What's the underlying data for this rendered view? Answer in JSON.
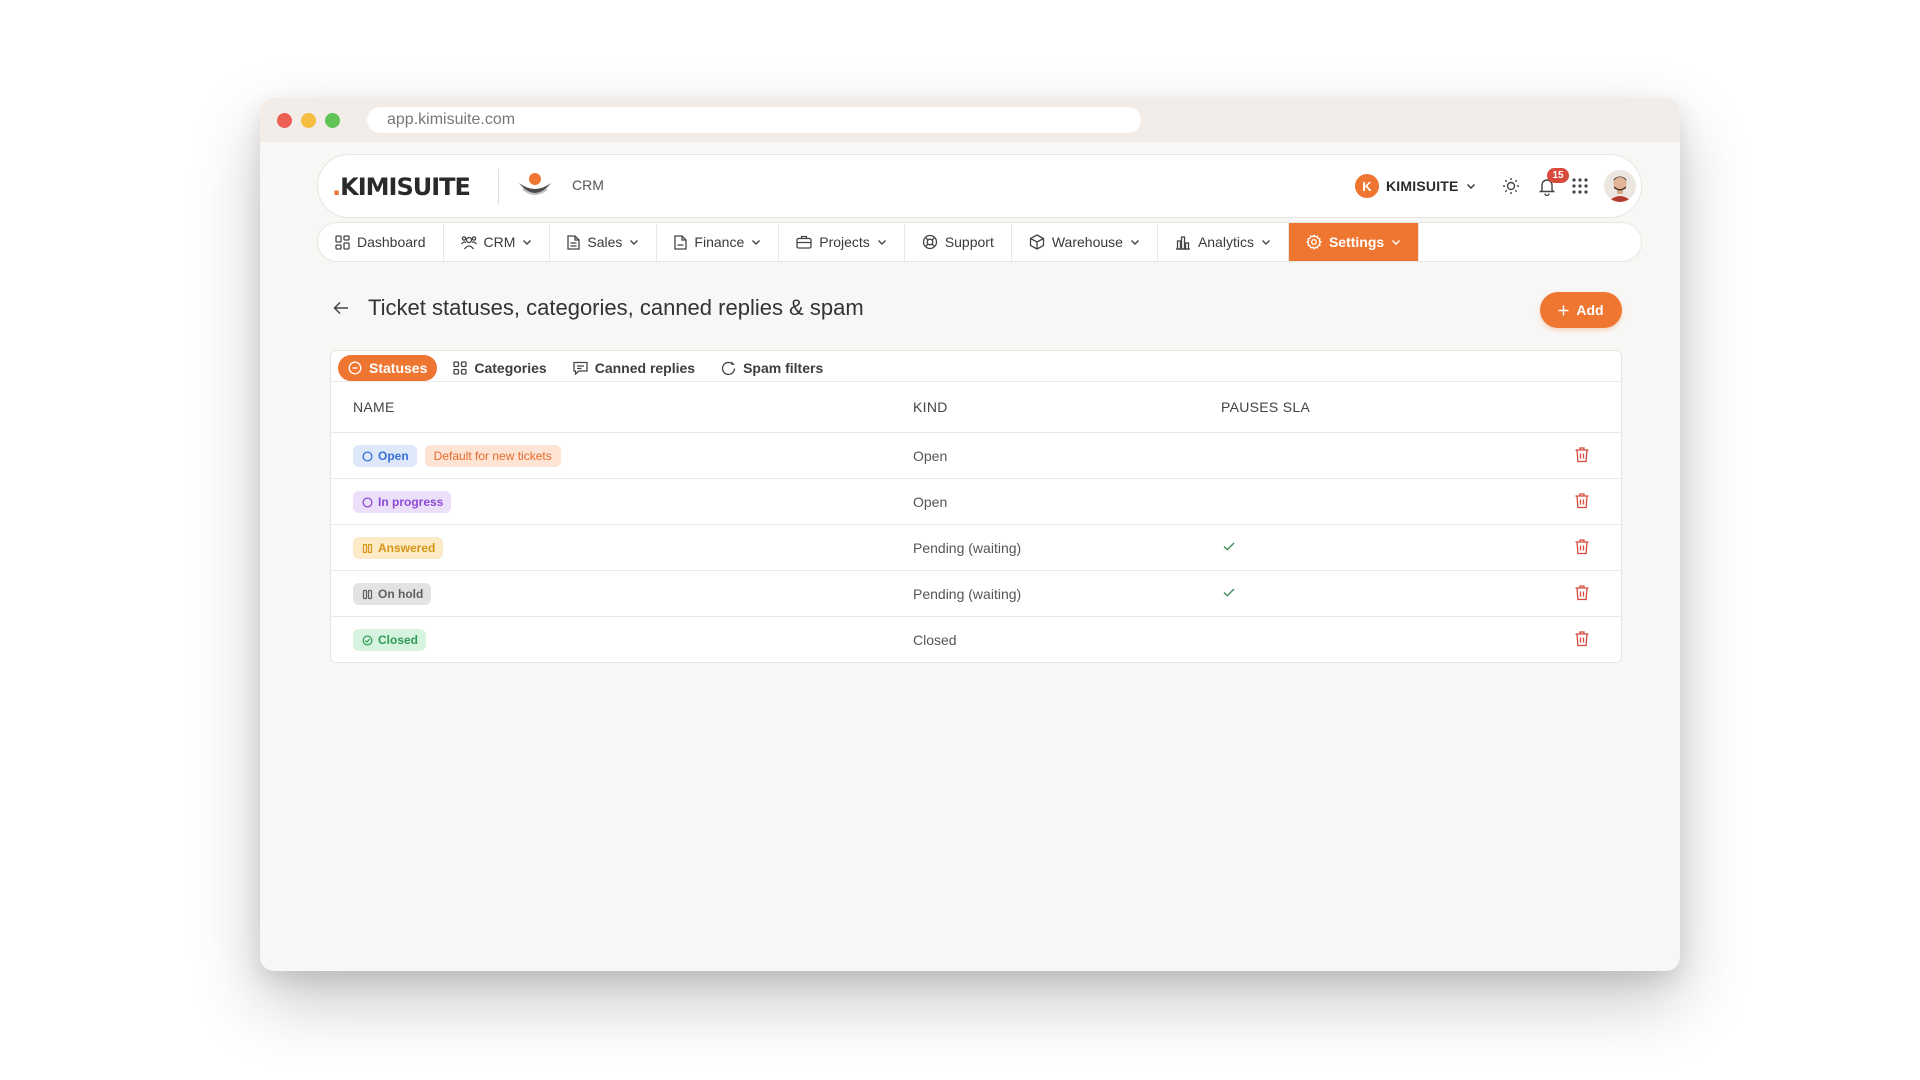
{
  "browser": {
    "url": "app.kimisuite.com"
  },
  "header": {
    "logo_text": "KIMISUITE",
    "app_label": "CRM",
    "org_initial": "K",
    "org_name": "KIMISUITE",
    "notification_count": "15"
  },
  "nav": {
    "items": [
      {
        "label": "Dashboard",
        "icon": "dashboard-icon"
      },
      {
        "label": "CRM",
        "icon": "users-icon"
      },
      {
        "label": "Sales",
        "icon": "document-icon"
      },
      {
        "label": "Finance",
        "icon": "file-icon"
      },
      {
        "label": "Projects",
        "icon": "briefcase-icon"
      },
      {
        "label": "Support",
        "icon": "lifebuoy-icon"
      },
      {
        "label": "Warehouse",
        "icon": "box-icon"
      },
      {
        "label": "Analytics",
        "icon": "bar-chart-icon"
      },
      {
        "label": "Settings",
        "icon": "gear-icon",
        "active": true
      }
    ]
  },
  "page": {
    "title": "Ticket statuses, categories, canned replies & spam",
    "add_label": "Add"
  },
  "tabs": [
    {
      "label": "Statuses",
      "active": true
    },
    {
      "label": "Categories"
    },
    {
      "label": "Canned replies"
    },
    {
      "label": "Spam filters"
    }
  ],
  "table": {
    "columns": [
      "NAME",
      "KIND",
      "PAUSES SLA"
    ],
    "rows": [
      {
        "name": "Open",
        "default_badge": "Default for new tickets",
        "kind": "Open",
        "pauses_sla": false
      },
      {
        "name": "In progress",
        "kind": "Open",
        "pauses_sla": false
      },
      {
        "name": "Answered",
        "kind": "Pending (waiting)",
        "pauses_sla": true
      },
      {
        "name": "On hold",
        "kind": "Pending (waiting)",
        "pauses_sla": true
      },
      {
        "name": "Closed",
        "kind": "Closed",
        "pauses_sla": false
      }
    ]
  },
  "colors": {
    "accent": "#ee7631",
    "open": "#3a6fd8",
    "in_progress": "#8e4ad6",
    "answered": "#d69517",
    "on_hold": "#5f5f5f",
    "closed": "#2f9b54",
    "delete": "#d84a3b"
  }
}
